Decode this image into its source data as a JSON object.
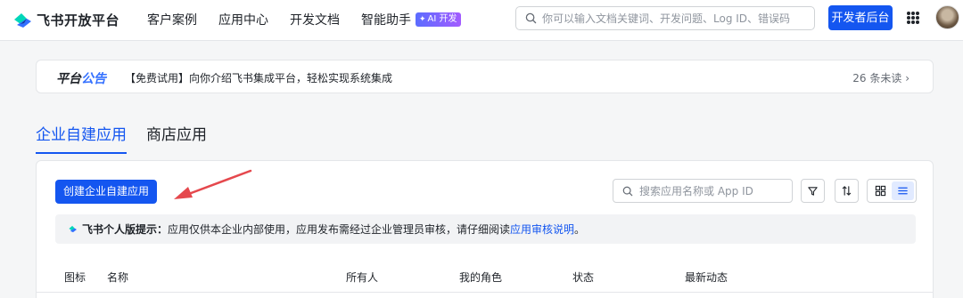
{
  "header": {
    "logo_text": "飞书开放平台",
    "nav": [
      "客户案例",
      "应用中心",
      "开发文档",
      "智能助手"
    ],
    "ai_badge": "AI 开发",
    "search_placeholder": "你可以输入文档关键词、开发问题、Log ID、错误码",
    "developer_console_label": "开发者后台"
  },
  "notice": {
    "title_part1": "平台",
    "title_part2": "公告",
    "text": "【免费试用】向你介绍飞书集成平台，轻松实现系统集成",
    "unread": "26 条未读"
  },
  "tabs": [
    {
      "label": "企业自建应用",
      "active": true
    },
    {
      "label": "商店应用",
      "active": false
    }
  ],
  "panel": {
    "create_button": "创建企业自建应用",
    "search_placeholder": "搜索应用名称或 App ID",
    "tip_label": "飞书个人版提示：",
    "tip_body": "应用仅供本企业内部使用，应用发布需经过企业管理员审核，请仔细阅读 ",
    "tip_link": "应用审核说明",
    "tip_end": "。",
    "columns": [
      "图标",
      "名称",
      "所有人",
      "我的角色",
      "状态",
      "最新动态"
    ]
  },
  "colors": {
    "primary": "#1456f0",
    "arrow": "#e5484d",
    "page_bg": "#f5f6f7"
  },
  "icons": [
    "search-icon",
    "filter-icon",
    "sort-icon",
    "grid-view-icon",
    "list-view-icon",
    "apps-grid-icon",
    "lark-logo-icon"
  ]
}
